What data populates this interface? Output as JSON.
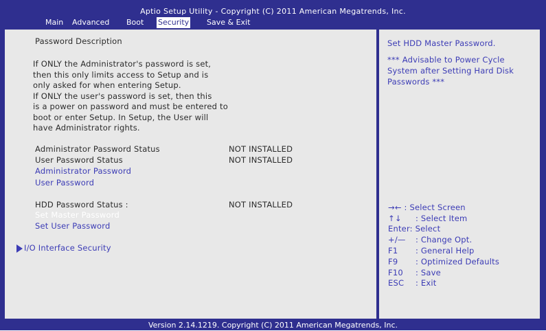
{
  "header": {
    "title": "Aptio Setup Utility - Copyright (C) 2011 American Megatrends, Inc."
  },
  "tabs": [
    {
      "label": "Main"
    },
    {
      "label": "Advanced"
    },
    {
      "label": "Boot"
    },
    {
      "label": "Security"
    },
    {
      "label": "Save & Exit"
    }
  ],
  "main": {
    "section_title": "Password Description",
    "description_lines": [
      "If ONLY the Administrator's password is set,",
      "then this only limits access to Setup and is",
      "only asked for when entering Setup.",
      "If ONLY the user's password is set, then this",
      "is a power on password and must be entered to",
      "boot or enter Setup. In Setup, the User will",
      "have Administrator rights."
    ],
    "admin_status_label": "Administrator Password Status",
    "admin_status_value": "NOT INSTALLED",
    "user_status_label": "User Password Status",
    "user_status_value": "NOT INSTALLED",
    "admin_password_link": "Administrator Password",
    "user_password_link": "User Password",
    "hdd_status_label": "HDD Password Status :",
    "hdd_status_value": "NOT INSTALLED",
    "set_master_password": "Set Master Password",
    "set_user_password": "Set User Password",
    "io_security": "I/O Interface Security"
  },
  "help": {
    "title": "Set HDD Master Password.",
    "note_lines": [
      "*** Advisable to Power Cycle",
      "System after Setting Hard Disk",
      "Passwords ***"
    ],
    "keys": [
      {
        "key": "→←",
        "desc": ": Select Screen"
      },
      {
        "key": "↑↓",
        "desc": ": Select Item"
      },
      {
        "key": "Enter",
        "desc": ": Select"
      },
      {
        "key": "+/—",
        "desc": ": Change Opt."
      },
      {
        "key": "F1",
        "desc": ": General Help"
      },
      {
        "key": "F9",
        "desc": ": Optimized Defaults"
      },
      {
        "key": "F10",
        "desc": ": Save"
      },
      {
        "key": "ESC",
        "desc": ": Exit"
      }
    ]
  },
  "footer": {
    "version": "Version 2.14.1219. Copyright (C) 2011 American Megatrends, Inc."
  }
}
